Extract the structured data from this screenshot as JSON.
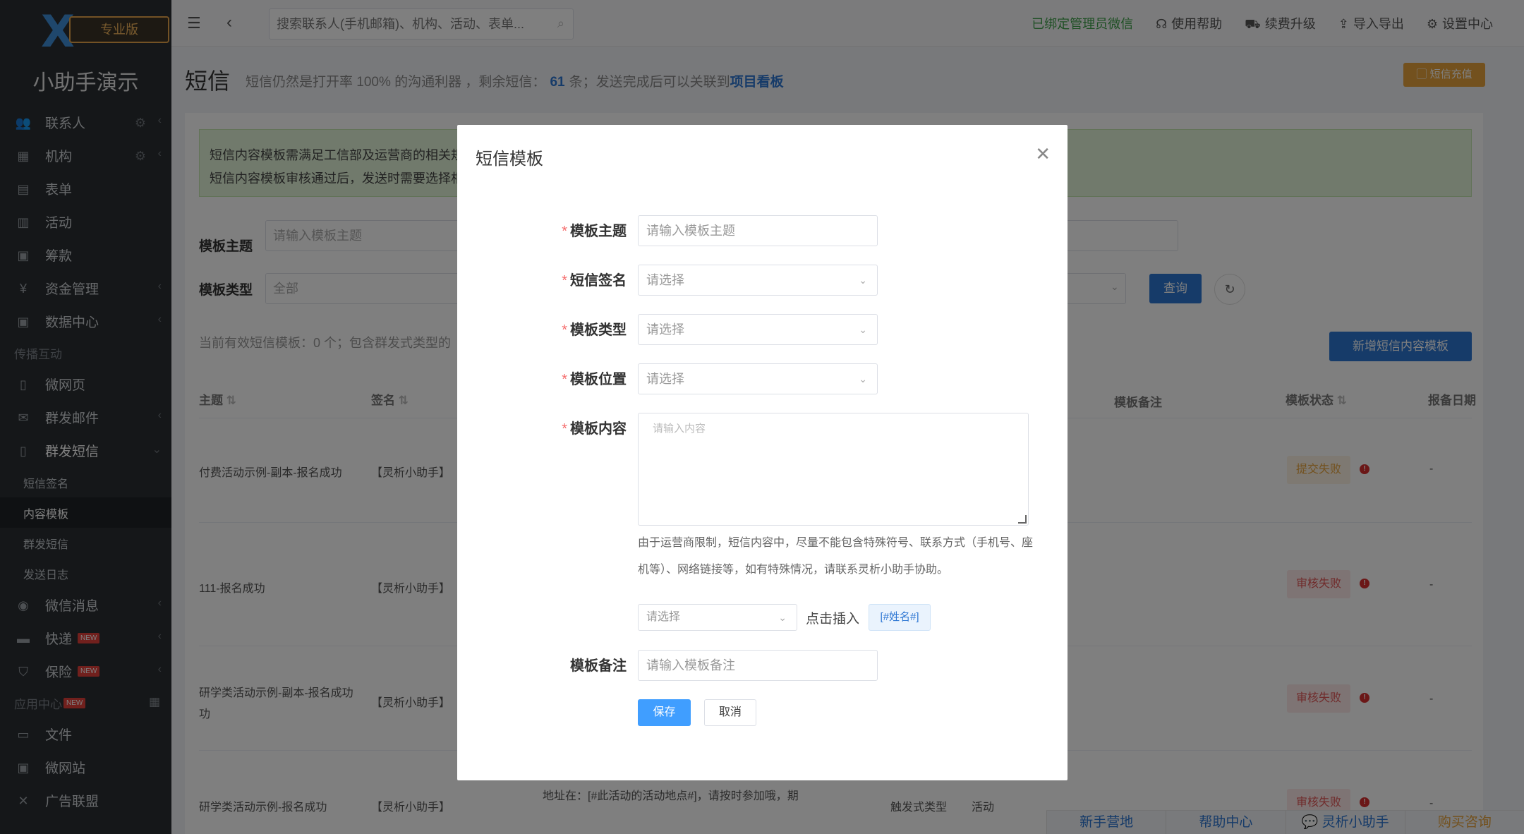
{
  "sidebar": {
    "logo_badge": "专业版",
    "brand_name": "小助手演示",
    "items": [
      {
        "label": "联系人",
        "icon": "users-icon"
      },
      {
        "label": "机构",
        "icon": "building-icon"
      },
      {
        "label": "表单",
        "icon": "form-icon"
      },
      {
        "label": "活动",
        "icon": "calendar-icon"
      },
      {
        "label": "筹款",
        "icon": "fundraise-icon"
      },
      {
        "label": "资金管理",
        "icon": "yen-icon"
      },
      {
        "label": "数据中心",
        "icon": "data-icon"
      }
    ],
    "section_broadcast": "传播互动",
    "items2": [
      {
        "label": "微网页",
        "icon": "page-icon"
      },
      {
        "label": "群发邮件",
        "icon": "mail-icon"
      },
      {
        "label": "群发短信",
        "icon": "phone-icon"
      }
    ],
    "sms_sub": [
      "短信签名",
      "内容模板",
      "群发短信",
      "发送日志"
    ],
    "items3": [
      {
        "label": "微信消息",
        "icon": "wechat-icon"
      },
      {
        "label": "快递",
        "icon": "truck-icon",
        "new": "NEW"
      },
      {
        "label": "保险",
        "icon": "shield-icon",
        "new": "NEW"
      }
    ],
    "section_apps": "应用中心",
    "section_apps_new": "NEW",
    "items4": [
      {
        "label": "文件",
        "icon": "folder-icon"
      },
      {
        "label": "微网站",
        "icon": "site-icon"
      },
      {
        "label": "广告联盟",
        "icon": "ad-icon"
      }
    ]
  },
  "topbar": {
    "search_placeholder": "搜索联系人(手机邮箱)、机构、活动、表单...",
    "wechat_bound": "已绑定管理员微信",
    "help": "使用帮助",
    "renew": "续费升级",
    "import_export": "导入导出",
    "settings": "设置中心"
  },
  "page": {
    "title": "短信",
    "desc_prefix": "短信仍然是打开率 100% 的沟通利器 ，剩余短信：",
    "remaining": "61",
    "desc_suffix": "条；发送完成后可以关联到",
    "board_link": "项目看板",
    "recharge": "短信充值"
  },
  "notice": {
    "line1": "短信内容模板需满足工信部及运营商的相关规",
    "line2": "短信内容模板审核通过后，发送时需要选择相"
  },
  "filters": {
    "subject_label": "模板主题",
    "subject_placeholder": "请输入模板主题",
    "type_label": "模板类型",
    "type_value": "全部",
    "query": "查询",
    "add": "新增短信内容模板",
    "count_text": "当前有效短信模板：0 个；包含群发式类型的"
  },
  "table": {
    "headers": [
      "主题",
      "签名",
      "模板备注",
      "模板状态",
      "报备日期"
    ],
    "rows": [
      {
        "subject": "付费活动示例-副本-报名成功",
        "sign": "【灵析小助手】",
        "status": "提交失败",
        "date": "-"
      },
      {
        "subject": "111-报名成功",
        "sign": "【灵析小助手】",
        "status": "审核失败",
        "date": "-"
      },
      {
        "subject": "研学类活动示例-副本-报名成功",
        "subject2": "功",
        "sign": "【灵析小助手】",
        "status": "审核失败",
        "date": "-"
      },
      {
        "subject": "研学类活动示例-报名成功",
        "sign": "【灵析小助手】",
        "content": "地址在：[#此活动的活动地点#]，请按时参加哦，期",
        "type": "触发式类型",
        "position": "活动",
        "status": "审核失败",
        "date": "-"
      }
    ]
  },
  "footer": [
    "新手营地",
    "帮助中心",
    "灵析小助手",
    "购买咨询"
  ],
  "modal": {
    "title": "短信模板",
    "subject_label": "模板主题",
    "subject_placeholder": "请输入模板主题",
    "sign_label": "短信签名",
    "type_label": "模板类型",
    "position_label": "模板位置",
    "select_placeholder": "请选择",
    "content_label": "模板内容",
    "content_placeholder": "请输入内容",
    "hint": "由于运营商限制，短信内容中，尽量不能包含特殊符号、联系方式（手机号、座机等）、网络链接等，如有特殊情况，请联系灵析小助手协助。",
    "insert_select_placeholder": "请选择",
    "insert_label": "点击插入",
    "insert_tag": "[#姓名#]",
    "remark_label": "模板备注",
    "remark_placeholder": "请输入模板备注",
    "save": "保存",
    "cancel": "取消"
  }
}
